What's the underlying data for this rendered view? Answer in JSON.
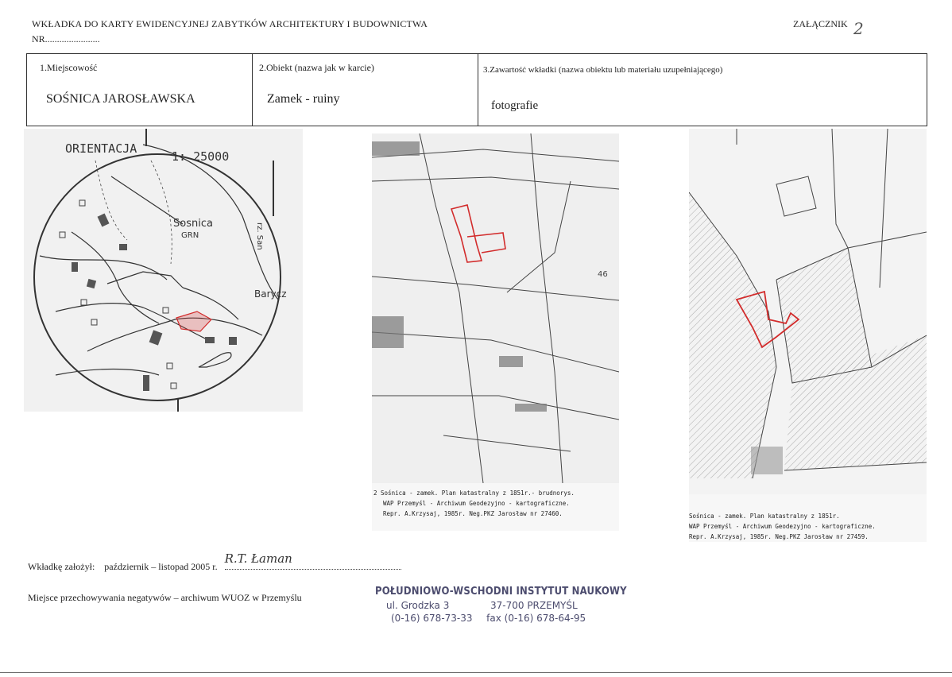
{
  "header": {
    "title": "WKŁADKA DO KARTY EWIDENCYJNEJ ZABYTKÓW ARCHITEKTURY I BUDOWNICTWA",
    "nr": "NR.......................",
    "annex": "ZAŁĄCZNIK",
    "annex_handwritten": "2"
  },
  "fields": {
    "f1_label": "1.Miejscowość",
    "f1_value": "SOŚNICA JAROSŁAWSKA",
    "f2_label": "2.Obiekt (nazwa jak w karcie)",
    "f2_value": "Zamek - ruiny",
    "f3_label": "3.Zawartość wkładki (nazwa obiektu lub materiału uzupełniającego)",
    "f3_value": "fotografie"
  },
  "map1": {
    "orientation": "ORIENTACJA",
    "scale": "1: 25000",
    "place": "Sosnica",
    "grn": "GRN",
    "river": "rz. San",
    "village": "Barycz"
  },
  "map2": {
    "number": "46",
    "caption_lines": [
      "2 Sośnica - zamek. Plan katastralny z 1851r.- brudnorys.",
      "WAP Przemyśl - Archiwum Geodezyjno - kartograficzne.",
      "Repr. A.Krzysaj, 1985r. Neg.PKZ Jarosław nr 27460."
    ]
  },
  "map3": {
    "caption_lines": [
      "Sośnica - zamek. Plan katastralny z 1851r.",
      "WAP Przemyśl - Archiwum Geodezyjno - kartograficzne.",
      "Repr. A.Krzysaj, 1985r. Neg.PKZ Jarosław nr 27459."
    ]
  },
  "footer": {
    "created_label": "Wkładkę założył:",
    "created_date": "październik – listopad  2005 r.",
    "signature": "R.T. Łaman",
    "negatives": "Miejsce przechowywania  negatywów – archiwum WUOZ w Przemyślu"
  },
  "stamp": {
    "name": "POŁUDNIOWO-WSCHODNI INSTYTUT NAUKOWY",
    "street": "ul. Grodzka 3",
    "city": "37-700 PRZEMYŚL",
    "phone": "(0-16) 678-73-33",
    "fax": "fax (0-16) 678-64-95"
  },
  "colors": {
    "highlight": "#d22c2c",
    "stamp": "#4c4c6e"
  }
}
